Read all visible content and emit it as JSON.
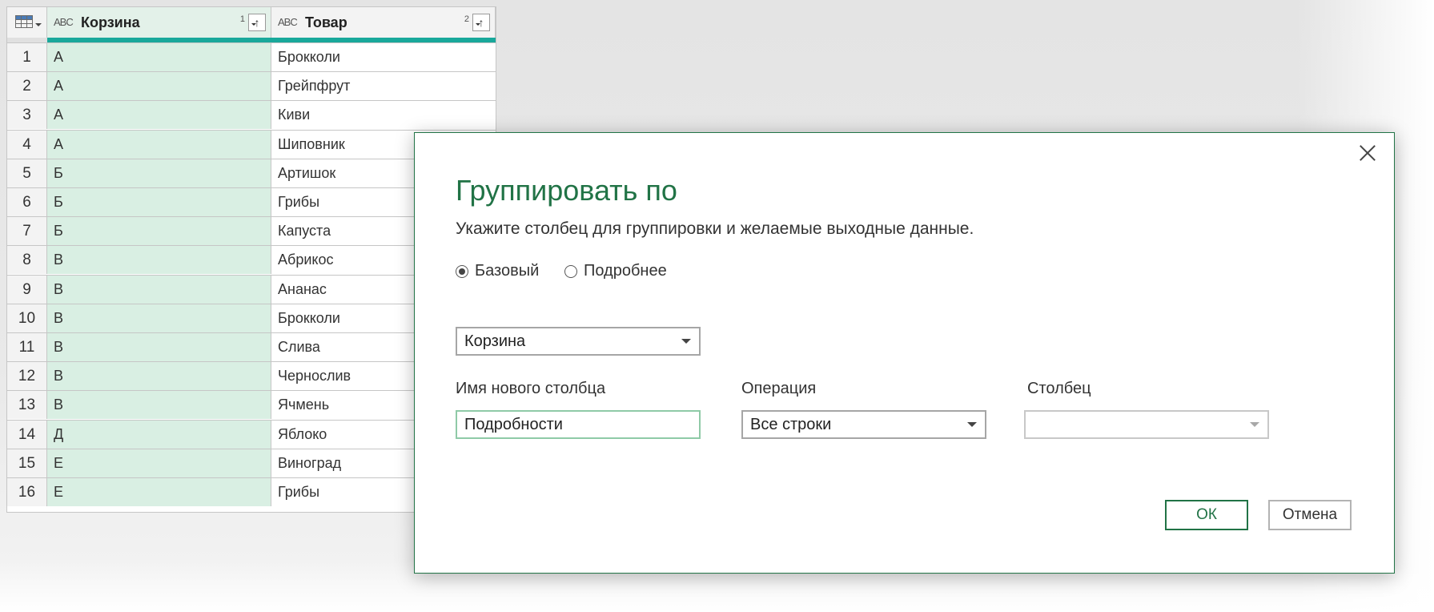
{
  "grid": {
    "columns": [
      {
        "type_icon": "ABC",
        "title": "Корзина",
        "sort_order": "1"
      },
      {
        "type_icon": "ABC",
        "title": "Товар",
        "sort_order": "2"
      }
    ],
    "rows": [
      {
        "n": "1",
        "basket": "А",
        "item": "Брокколи"
      },
      {
        "n": "2",
        "basket": "А",
        "item": "Грейпфрут"
      },
      {
        "n": "3",
        "basket": "А",
        "item": "Киви"
      },
      {
        "n": "4",
        "basket": "А",
        "item": "Шиповник"
      },
      {
        "n": "5",
        "basket": "Б",
        "item": "Артишок"
      },
      {
        "n": "6",
        "basket": "Б",
        "item": "Грибы"
      },
      {
        "n": "7",
        "basket": "Б",
        "item": "Капуста"
      },
      {
        "n": "8",
        "basket": "В",
        "item": "Абрикос"
      },
      {
        "n": "9",
        "basket": "В",
        "item": "Ананас"
      },
      {
        "n": "10",
        "basket": "В",
        "item": "Брокколи"
      },
      {
        "n": "11",
        "basket": "В",
        "item": "Слива"
      },
      {
        "n": "12",
        "basket": "В",
        "item": "Чернослив"
      },
      {
        "n": "13",
        "basket": "В",
        "item": "Ячмень"
      },
      {
        "n": "14",
        "basket": "Д",
        "item": "Яблоко"
      },
      {
        "n": "15",
        "basket": "Е",
        "item": "Виноград"
      },
      {
        "n": "16",
        "basket": "Е",
        "item": "Грибы"
      }
    ]
  },
  "dialog": {
    "title": "Группировать по",
    "description": "Укажите столбец для группировки и желаемые выходные данные.",
    "radio_basic": "Базовый",
    "radio_advanced": "Подробнее",
    "radio_selected": "basic",
    "group_column_value": "Корзина",
    "new_column_label": "Имя нового столбца",
    "new_column_value": "Подробности",
    "operation_label": "Операция",
    "operation_value": "Все строки",
    "column_label": "Столбец",
    "column_value": "",
    "ok_label": "ОК",
    "cancel_label": "Отмена"
  },
  "colors": {
    "accent": "#217346",
    "quality_bar": "#19a89b",
    "selected_column": "#d9efe3"
  }
}
